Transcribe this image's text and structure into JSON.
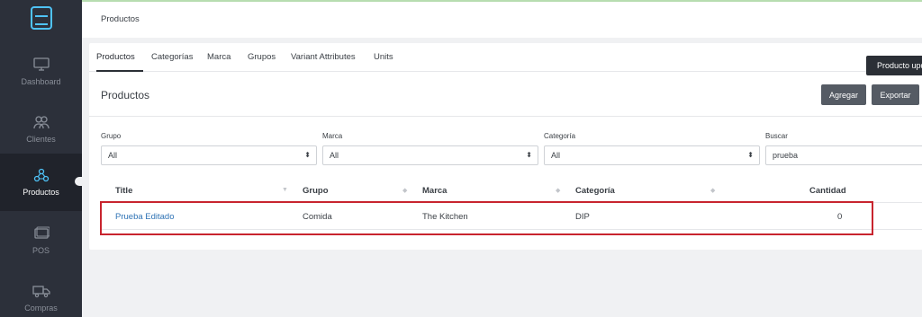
{
  "colors": {
    "sidebar_bg": "#2c303a",
    "sidebar_active": "#20232b",
    "link": "#2f73b5",
    "highlight": "#c8242e",
    "button": "#555b64"
  },
  "sidebar": {
    "logo_icon": "store-logo-icon",
    "items": [
      {
        "label": "Dashboard",
        "icon": "monitor-icon"
      },
      {
        "label": "Clientes",
        "icon": "users-icon"
      },
      {
        "label": "Productos",
        "icon": "products-icon",
        "active": true
      },
      {
        "label": "POS",
        "icon": "pos-icon"
      },
      {
        "label": "Compras",
        "icon": "truck-icon"
      }
    ]
  },
  "topbar": {
    "title": "Productos"
  },
  "tabs": [
    "Productos",
    "Categorías",
    "Marca",
    "Grupos",
    "Variant Attributes",
    "Units"
  ],
  "tooltip": "Producto upd",
  "section": {
    "title": "Productos",
    "add_label": "Agregar",
    "export_label": "Exportar"
  },
  "filters": {
    "grupo": {
      "label": "Grupo",
      "value": "All"
    },
    "marca": {
      "label": "Marca",
      "value": "All"
    },
    "categoria": {
      "label": "Categoría",
      "value": "All"
    },
    "buscar": {
      "label": "Buscar",
      "value": "prueba"
    }
  },
  "table": {
    "headers": [
      "Title",
      "Grupo",
      "Marca",
      "Categoría",
      "Cantidad"
    ],
    "rows": [
      {
        "title": "Prueba Editado",
        "grupo": "Comida",
        "marca": "The Kitchen",
        "categoria": "DIP",
        "cantidad": "0"
      }
    ]
  }
}
